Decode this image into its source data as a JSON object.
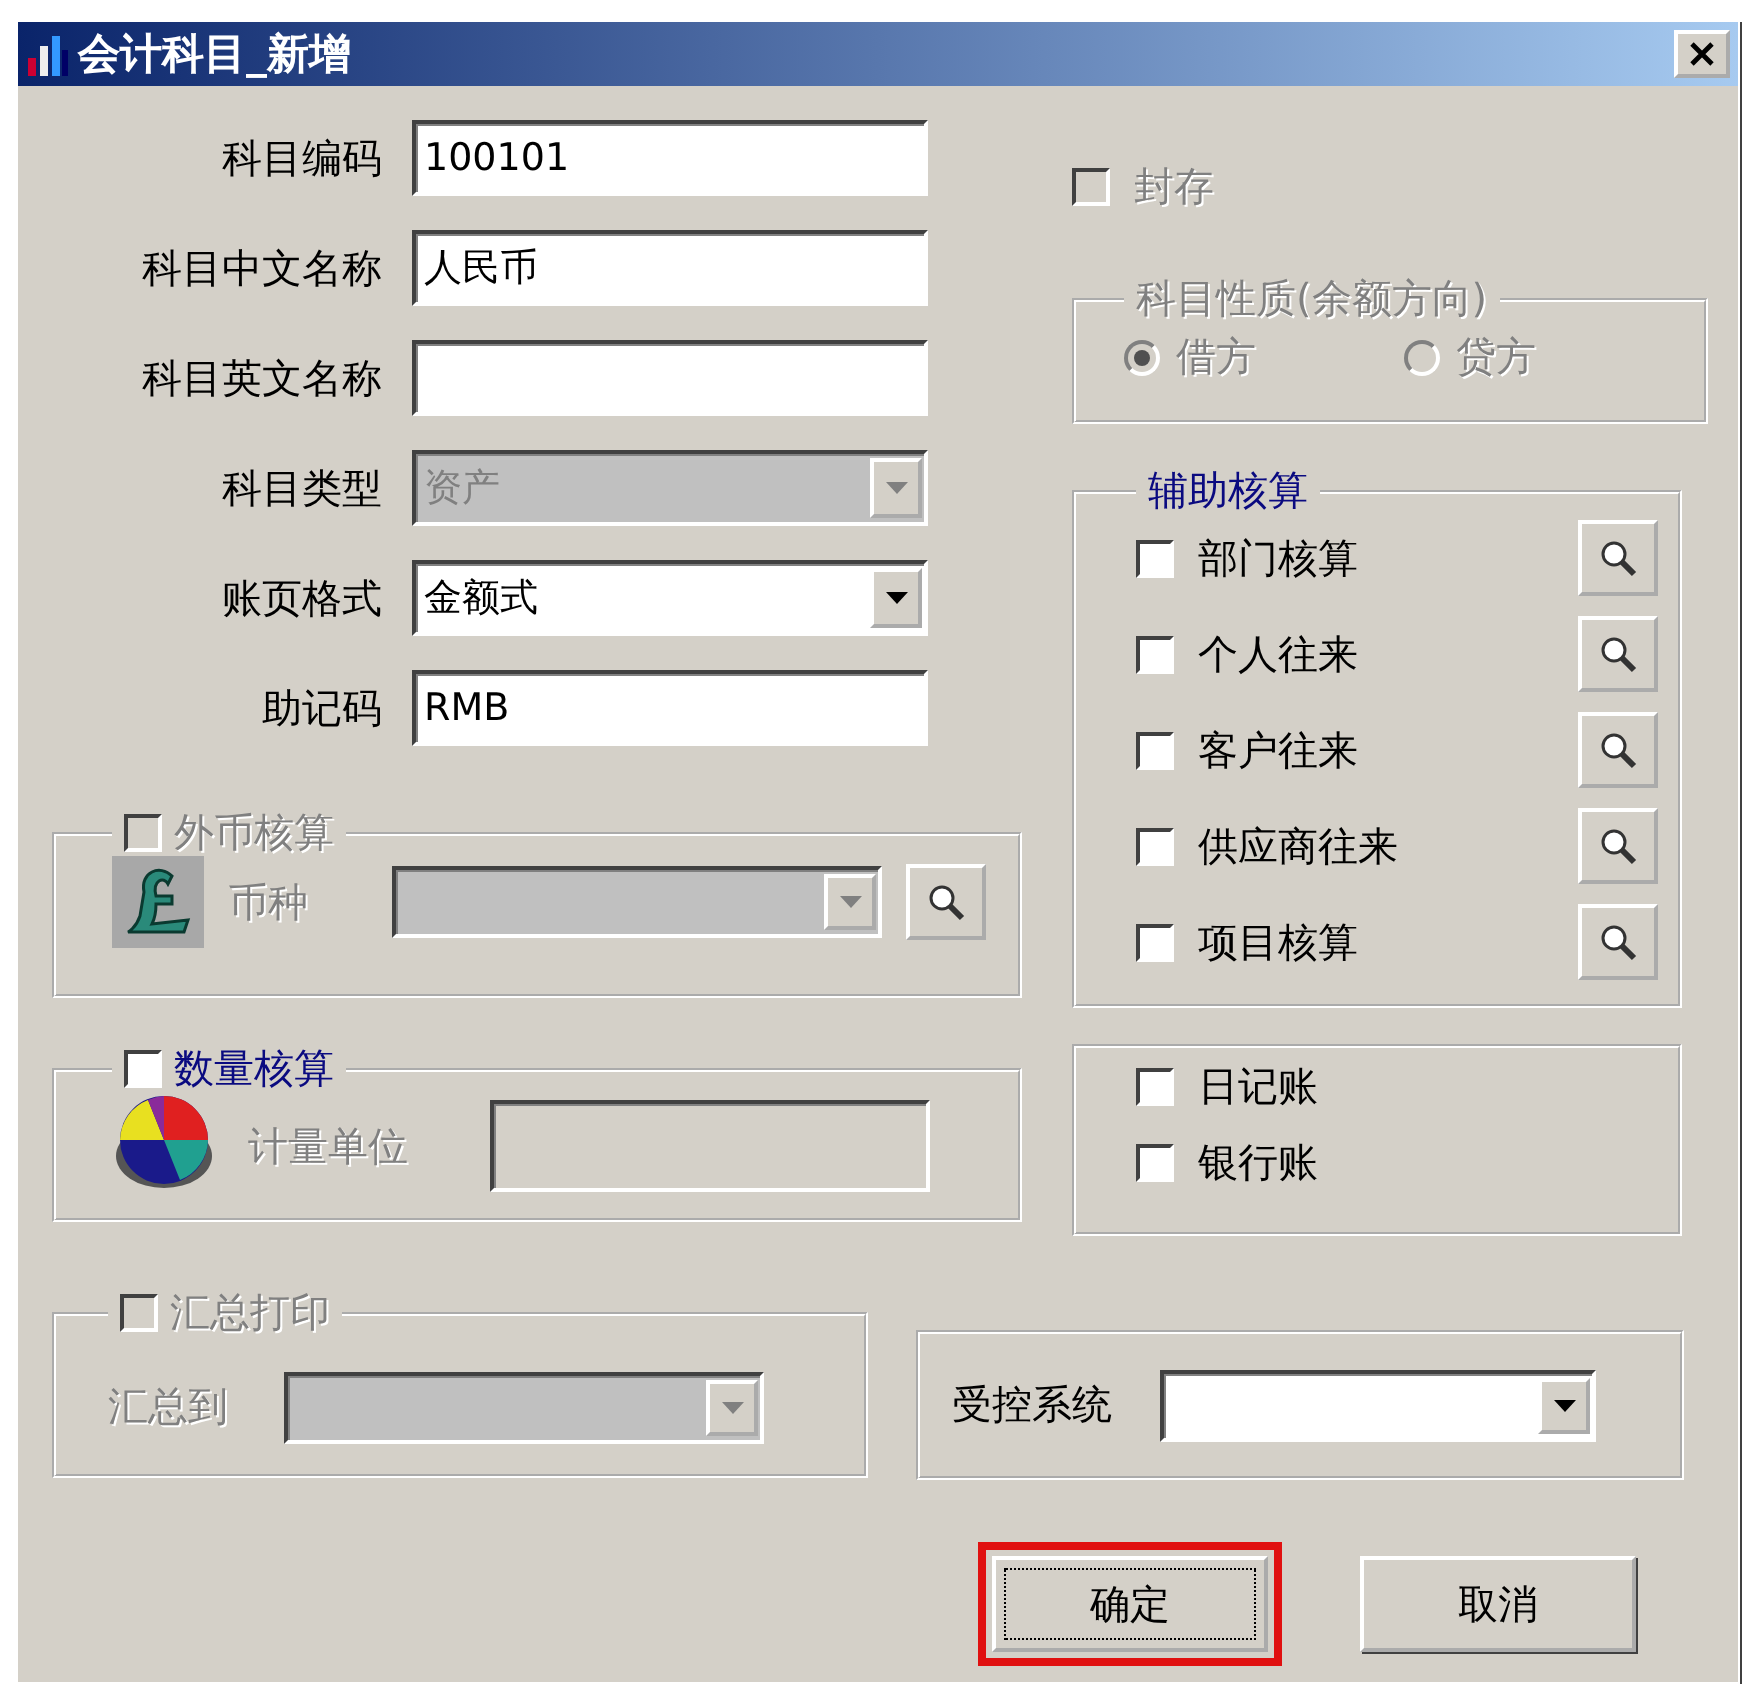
{
  "window": {
    "title": "会计科目_新增"
  },
  "fields": [
    {
      "label": "科目编码",
      "kind": "text",
      "value": "100101",
      "disabled": false
    },
    {
      "label": "科目中文名称",
      "kind": "text",
      "value": "人民币",
      "disabled": false
    },
    {
      "label": "科目英文名称",
      "kind": "text",
      "disabled": false
    },
    {
      "label": "科目类型",
      "kind": "select",
      "value": "资产",
      "disabled": true
    },
    {
      "label": "账页格式",
      "kind": "select",
      "value": "金额式",
      "disabled": false
    },
    {
      "label": "助记码",
      "kind": "text",
      "value": "RMB",
      "disabled": false
    }
  ],
  "archive": {
    "label": "封存",
    "checked": false,
    "disabled": true
  },
  "nature": {
    "title": "科目性质(余额方向)",
    "options": [
      {
        "label": "借方",
        "selected": true,
        "disabled": true
      },
      {
        "label": "贷方",
        "selected": false,
        "disabled": true
      }
    ]
  },
  "auxiliary": {
    "title": "辅助核算",
    "items": [
      {
        "label": "部门核算",
        "checked": false
      },
      {
        "label": "个人往来",
        "checked": false
      },
      {
        "label": "客户往来",
        "checked": false
      },
      {
        "label": "供应商往来",
        "checked": false
      },
      {
        "label": "项目核算",
        "checked": false
      }
    ]
  },
  "ledgers": [
    {
      "label": "日记账",
      "checked": false
    },
    {
      "label": "银行账",
      "checked": false
    }
  ],
  "currency": {
    "label": "外币核算",
    "checked": false,
    "disabled": true,
    "field_label": "币种"
  },
  "quantity": {
    "label": "数量核算",
    "checked": false,
    "disabled": false,
    "field_label": "计量单位"
  },
  "summary": {
    "label": "汇总打印",
    "checked": false,
    "disabled": true,
    "field_label": "汇总到"
  },
  "controlled_system": {
    "label": "受控系统"
  },
  "buttons": [
    {
      "label": "确定",
      "highlighted": true
    },
    {
      "label": "取消",
      "highlighted": false
    }
  ]
}
